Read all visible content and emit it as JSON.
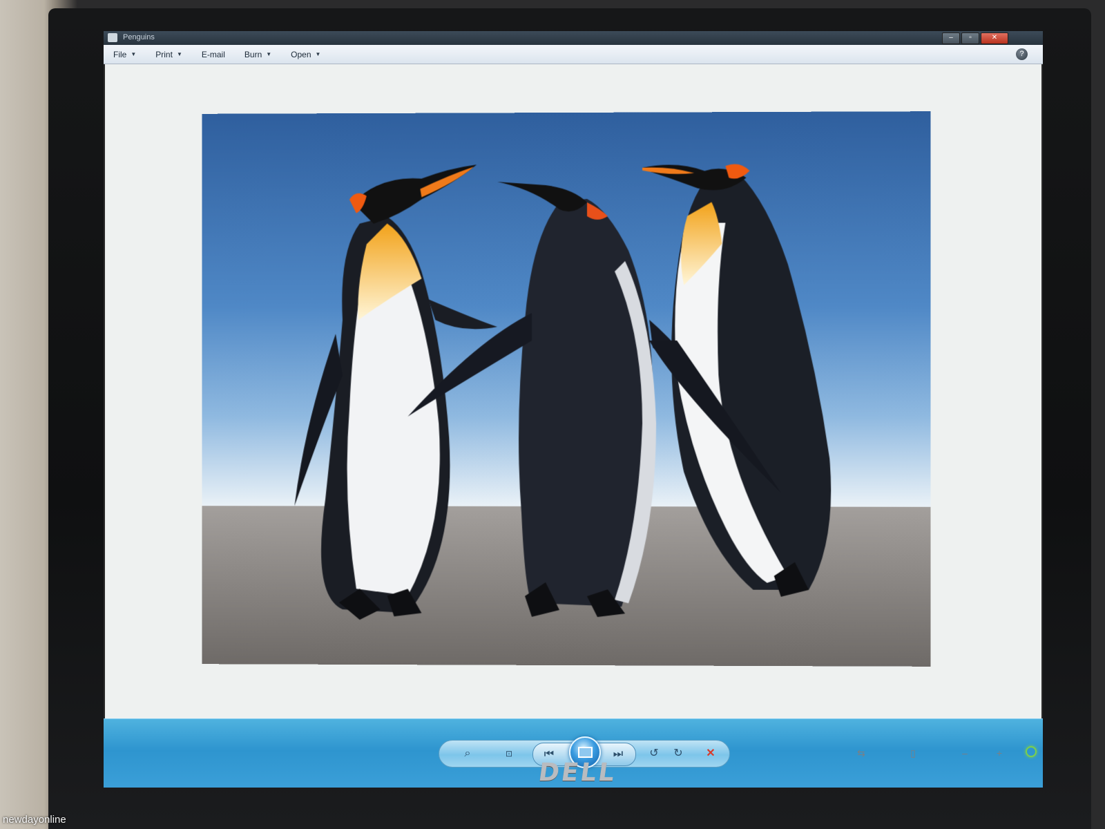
{
  "window": {
    "title": "Penguins"
  },
  "menu": [
    {
      "label": "File",
      "has_dropdown": true
    },
    {
      "label": "Print",
      "has_dropdown": true
    },
    {
      "label": "E-mail",
      "has_dropdown": false
    },
    {
      "label": "Burn",
      "has_dropdown": true
    },
    {
      "label": "Open",
      "has_dropdown": true
    }
  ],
  "controls": {
    "zoom_icon": "magnifier-icon",
    "actual_size_icon": "fit-icon",
    "previous_icon": "previous-icon",
    "slideshow_icon": "slideshow-icon",
    "next_icon": "next-icon",
    "rotate_ccw_icon": "rotate-ccw-icon",
    "rotate_cw_icon": "rotate-cw-icon",
    "delete_icon": "delete-icon"
  },
  "monitor": {
    "brand": "DELL"
  },
  "watermark": "newdayonline",
  "colors": {
    "control_bar": "#2e95cf",
    "power_led": "#7dd04a",
    "delete": "#d93a2a"
  }
}
